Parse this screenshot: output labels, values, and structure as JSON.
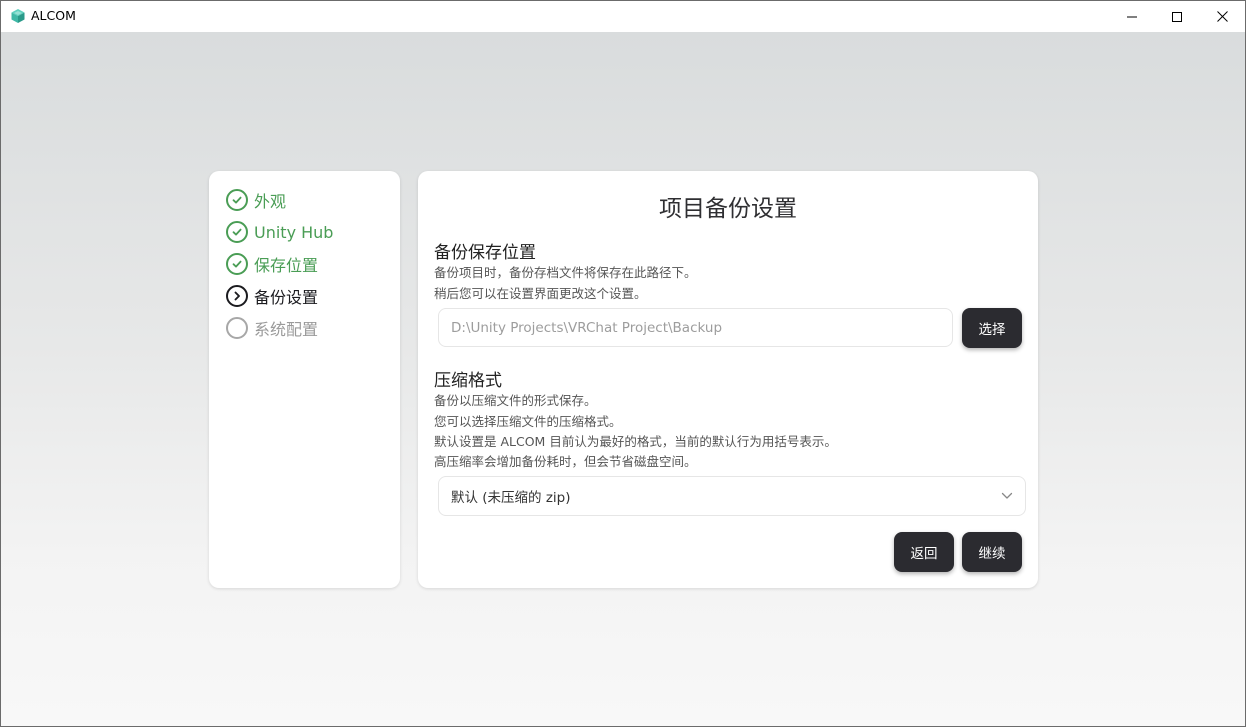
{
  "window": {
    "title": "ALCOM"
  },
  "steps": [
    {
      "label": "外观",
      "state": "done"
    },
    {
      "label": "Unity Hub",
      "state": "done"
    },
    {
      "label": "保存位置",
      "state": "done"
    },
    {
      "label": "备份设置",
      "state": "current"
    },
    {
      "label": "系统配置",
      "state": "pending"
    }
  ],
  "main": {
    "title": "项目备份设置",
    "backup_location": {
      "heading": "备份保存位置",
      "desc_line1": "备份项目时，备份存档文件将保存在此路径下。",
      "desc_line2": "稍后您可以在设置界面更改这个设置。",
      "path_value": "D:\\Unity Projects\\VRChat Project\\Backup",
      "select_label": "选择"
    },
    "compression": {
      "heading": "压缩格式",
      "desc_line1": "备份以压缩文件的形式保存。",
      "desc_line2": "您可以选择压缩文件的压缩格式。",
      "desc_line3": "默认设置是 ALCOM 目前认为最好的格式，当前的默认行为用括号表示。",
      "desc_line4": "高压缩率会增加备份耗时，但会节省磁盘空间。",
      "selected_format": "默认 (未压缩的 zip)"
    },
    "back_label": "返回",
    "continue_label": "继续"
  },
  "colors": {
    "done": "#4a9d55",
    "current": "#1b1b1f",
    "pending": "#a7a7a7",
    "button_bg": "#2b2b30",
    "app_icon": "#3fb8a6"
  }
}
